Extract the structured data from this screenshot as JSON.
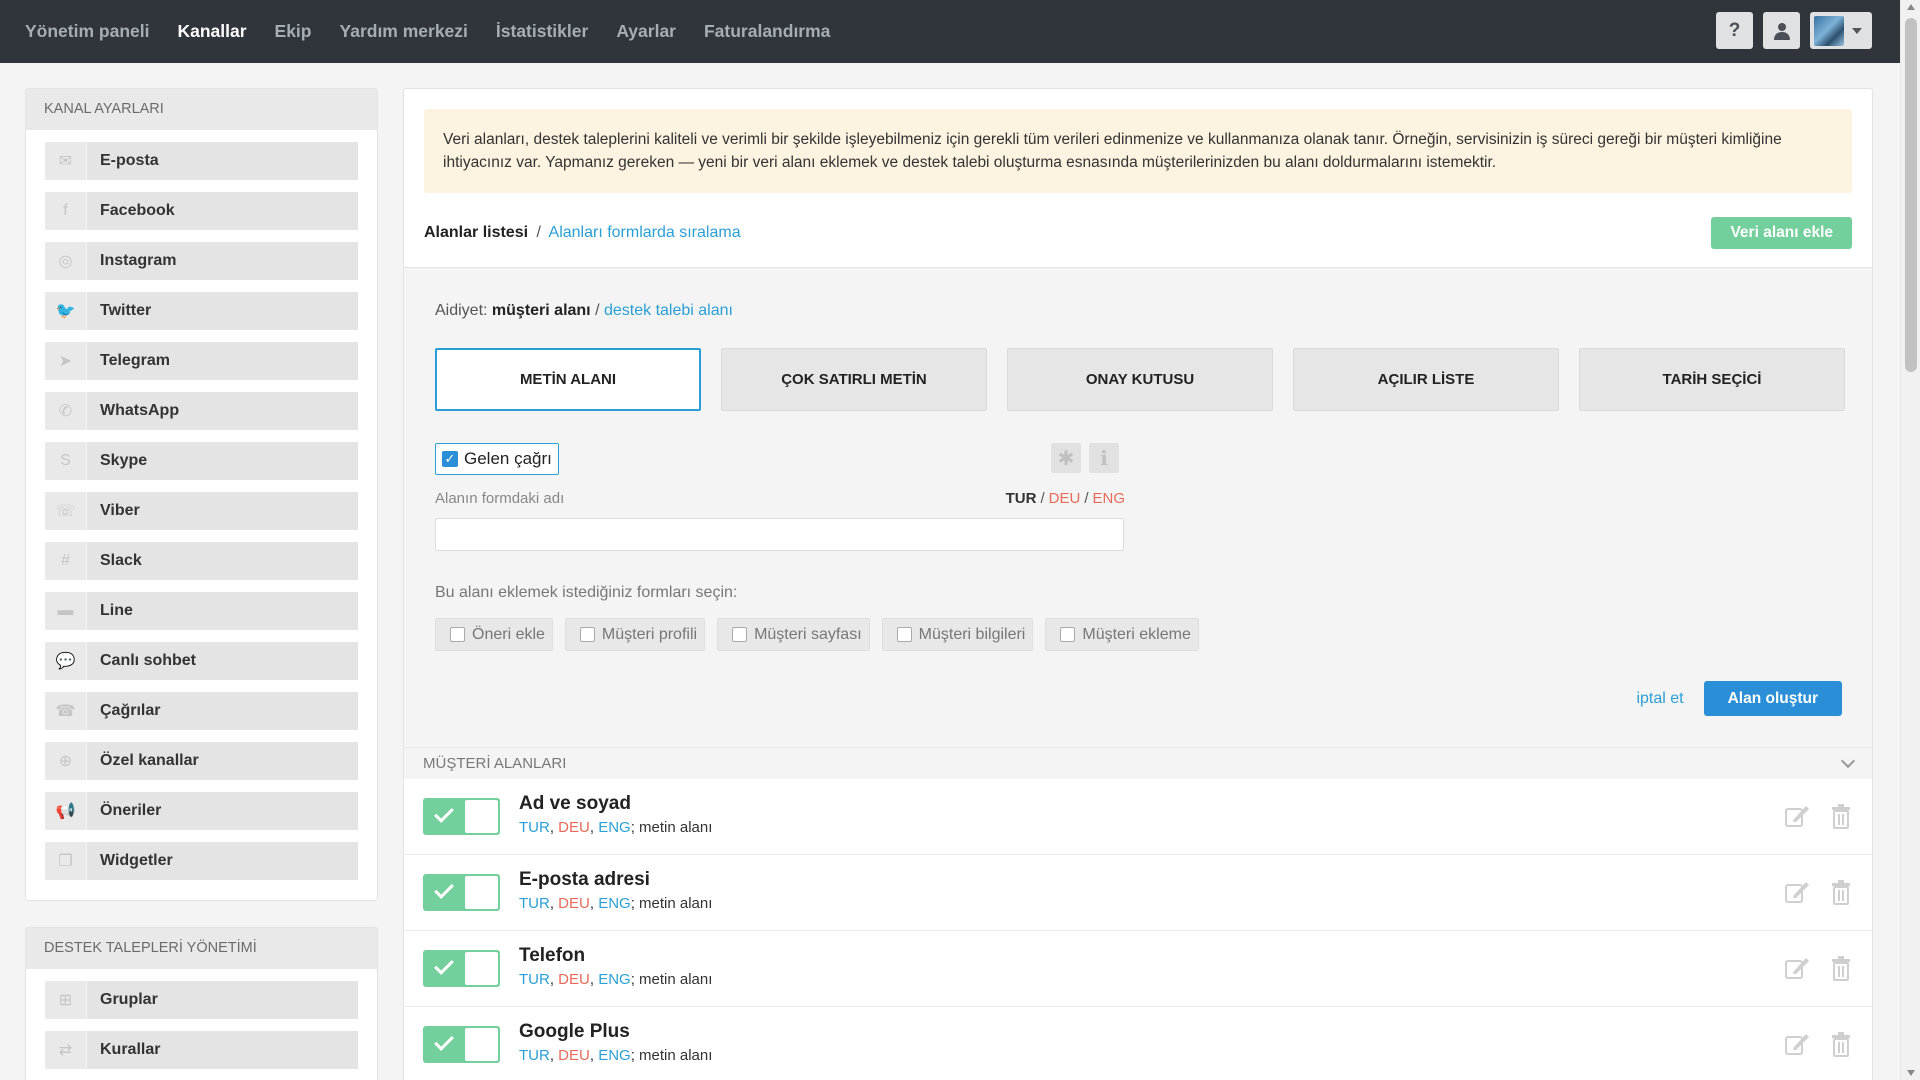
{
  "topnav": {
    "items": [
      "Yönetim paneli",
      "Kanallar",
      "Ekip",
      "Yardım merkezi",
      "İstatistikler",
      "Ayarlar",
      "Faturalandırma"
    ],
    "active": "Kanallar",
    "help_label": "?"
  },
  "sidebar": {
    "channels_title": "KANAL AYARLARI",
    "channels": [
      {
        "label": "E-posta",
        "icon": "envelope-icon"
      },
      {
        "label": "Facebook",
        "icon": "facebook-icon"
      },
      {
        "label": "Instagram",
        "icon": "instagram-icon"
      },
      {
        "label": "Twitter",
        "icon": "twitter-icon"
      },
      {
        "label": "Telegram",
        "icon": "telegram-icon"
      },
      {
        "label": "WhatsApp",
        "icon": "whatsapp-icon"
      },
      {
        "label": "Skype",
        "icon": "skype-icon"
      },
      {
        "label": "Viber",
        "icon": "viber-icon"
      },
      {
        "label": "Slack",
        "icon": "slack-icon"
      },
      {
        "label": "Line",
        "icon": "line-icon"
      },
      {
        "label": "Canlı sohbet",
        "icon": "chat-icon"
      },
      {
        "label": "Çağrılar",
        "icon": "phone-icon"
      },
      {
        "label": "Özel kanallar",
        "icon": "plus-circle-icon"
      },
      {
        "label": "Öneriler",
        "icon": "megaphone-icon"
      },
      {
        "label": "Widgetler",
        "icon": "cube-icon"
      }
    ],
    "tickets_title": "DESTEK TALEPLERİ YÖNETİMİ",
    "tickets": [
      {
        "label": "Gruplar",
        "icon": "sitemap-icon"
      },
      {
        "label": "Kurallar",
        "icon": "random-icon"
      }
    ]
  },
  "main": {
    "info_text": "Veri alanları, destek taleplerini kaliteli ve verimli bir şekilde işleyebilmeniz için gerekli tüm verileri edinmenize ve kullanmanıza olanak tanır. Örneğin, servisinizin iş süreci gereği bir müşteri kimliğine ihtiyacınız var. Yapmanız gereken — yeni bir veri alanı eklemek ve destek talebi oluşturma esnasında müşterilerinizden bu alanı doldurmalarını istemektir.",
    "breadcrumb": {
      "current": "Alanlar listesi",
      "sep": "/",
      "link": "Alanları formlarda sıralama"
    },
    "add_button": "Veri alanı ekle",
    "form": {
      "aidiyet_label": "Aidiyet:",
      "aidiyet_selected": "müşteri alanı",
      "aidiyet_sep": "/",
      "aidiyet_other": "destek talebi alanı",
      "types": [
        "METİN ALANI",
        "ÇOK SATIRLI METİN",
        "ONAY KUTUSU",
        "AÇILIR LİSTE",
        "TARİH SEÇİCİ"
      ],
      "active_type": "METİN ALANI",
      "incoming_label": "Gelen çağrı",
      "incoming_checked": true,
      "asterisk": "✱",
      "info_glyph": "i",
      "field_name_label": "Alanın formdaki adı",
      "lang_tur": "TUR",
      "lang_sep": "/",
      "lang_deu": "DEU",
      "lang_eng": "ENG",
      "field_name_value": "",
      "forms_label": "Bu alanı eklemek istediğiniz formları seçin:",
      "form_options": [
        "Öneri ekle",
        "Müşteri profili",
        "Müşteri sayfası",
        "Müşteri bilgileri",
        "Müşteri ekleme"
      ],
      "cancel": "iptal et",
      "submit": "Alan oluştur"
    },
    "customer_fields": {
      "title": "MÜŞTERİ ALANLARI",
      "rows": [
        {
          "name": "Ad ve soyad",
          "lang1": "TUR",
          "lang2": "DEU",
          "lang3": "ENG",
          "type": "; metin alanı",
          "enabled": true
        },
        {
          "name": "E-posta adresi",
          "lang1": "TUR",
          "lang2": "DEU",
          "lang3": "ENG",
          "type": "; metin alanı",
          "enabled": true
        },
        {
          "name": "Telefon",
          "lang1": "TUR",
          "lang2": "DEU",
          "lang3": "ENG",
          "type": "; metin alanı",
          "enabled": true
        },
        {
          "name": "Google Plus",
          "lang1": "TUR",
          "lang2": "DEU",
          "lang3": "ENG",
          "type": "; metin alanı",
          "enabled": true
        }
      ],
      "comma": ", "
    }
  },
  "colors": {
    "topbar": "#2f353b",
    "accent_blue": "#2a8fd6",
    "accent_green": "#73cf9b",
    "lang_red": "#e86a5a",
    "info_bg": "#fcf3e0"
  }
}
